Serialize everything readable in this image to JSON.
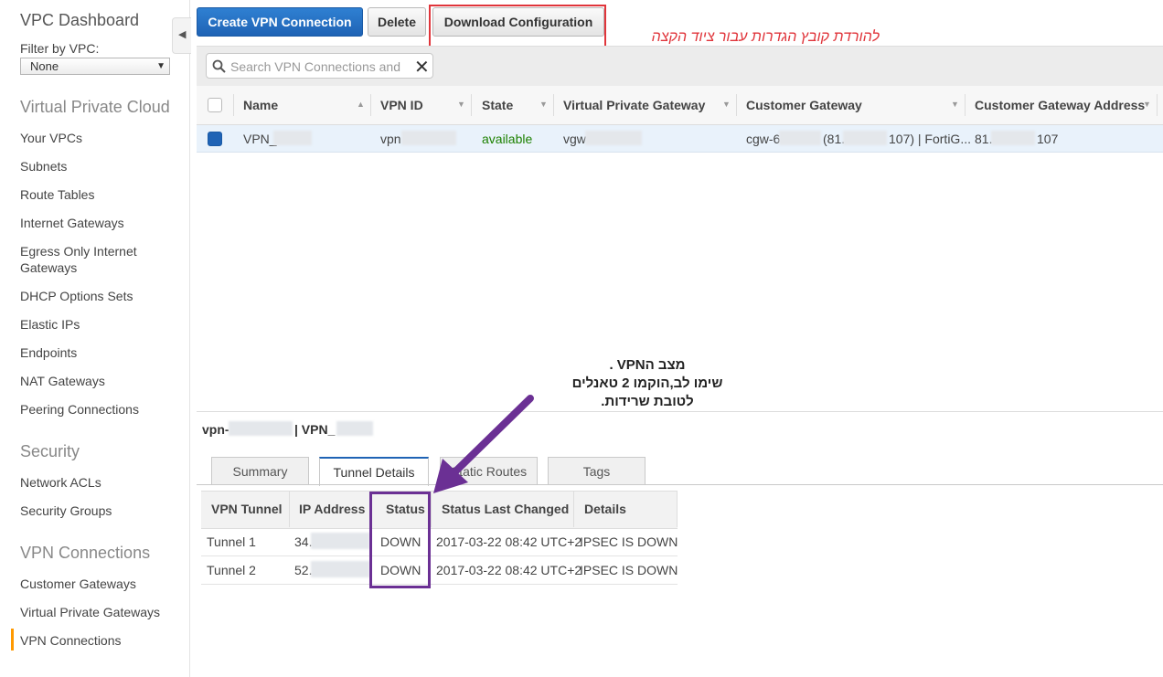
{
  "sidebar": {
    "title": "VPC Dashboard",
    "filter_label": "Filter by VPC:",
    "filter_value": "None",
    "section_vpc": "Virtual Private Cloud",
    "vpc_items": [
      "Your VPCs",
      "Subnets",
      "Route Tables",
      "Internet Gateways",
      "Egress Only Internet Gateways",
      "DHCP Options Sets",
      "Elastic IPs",
      "Endpoints",
      "NAT Gateways",
      "Peering Connections"
    ],
    "section_security": "Security",
    "security_items": [
      "Network ACLs",
      "Security Groups"
    ],
    "section_vpn": "VPN Connections",
    "vpn_items": [
      "Customer Gateways",
      "Virtual Private Gateways",
      "VPN Connections"
    ],
    "active_item": "VPN Connections"
  },
  "toolbar": {
    "create_label": "Create VPN Connection",
    "delete_label": "Delete",
    "download_label": "Download Configuration",
    "download_annotation": "להורדת קובץ הגדרות עבור ציוד הקצה"
  },
  "search": {
    "placeholder": "Search VPN Connections and"
  },
  "table": {
    "columns": [
      "Name",
      "VPN ID",
      "State",
      "Virtual Private Gateway",
      "Customer Gateway",
      "Customer Gateway Address"
    ],
    "rows": [
      {
        "name": "VPN_",
        "vpn_id": "vpn",
        "state": "available",
        "vgw": "vgw",
        "cgw_prefix": "cgw-6",
        "cgw_ip_start": "(81.",
        "cgw_suffix": "107) | FortiG...",
        "cgw_addr_start": "81.",
        "cgw_addr_end": "107"
      }
    ]
  },
  "details": {
    "title_left": "vpn-",
    "title_right": "| VPN_",
    "tabs": [
      "Summary",
      "Tunnel Details",
      "Static Routes",
      "Tags"
    ],
    "active_tab": "Tunnel Details",
    "columns": [
      "VPN Tunnel",
      "IP Address",
      "Status",
      "Status Last Changed",
      "Details"
    ],
    "rows": [
      {
        "tunnel": "Tunnel 1",
        "ip": "34.",
        "status": "DOWN",
        "changed": "2017-03-22 08:42 UTC+2",
        "details": "IPSEC IS DOWN"
      },
      {
        "tunnel": "Tunnel 2",
        "ip": "52.",
        "status": "DOWN",
        "changed": "2017-03-22 08:42 UTC+2",
        "details": "IPSEC IS DOWN"
      }
    ],
    "status_annotation": [
      "מצב הVPN .",
      "שימו לב,הוקמו 2 טאנלים",
      "לטובת שרידות."
    ]
  },
  "colors": {
    "primary": "#1f63b5",
    "annotation_red": "#e0353b",
    "annotation_purple": "#6b3094",
    "active_bar": "#ff9900",
    "available": "#1d8102"
  }
}
